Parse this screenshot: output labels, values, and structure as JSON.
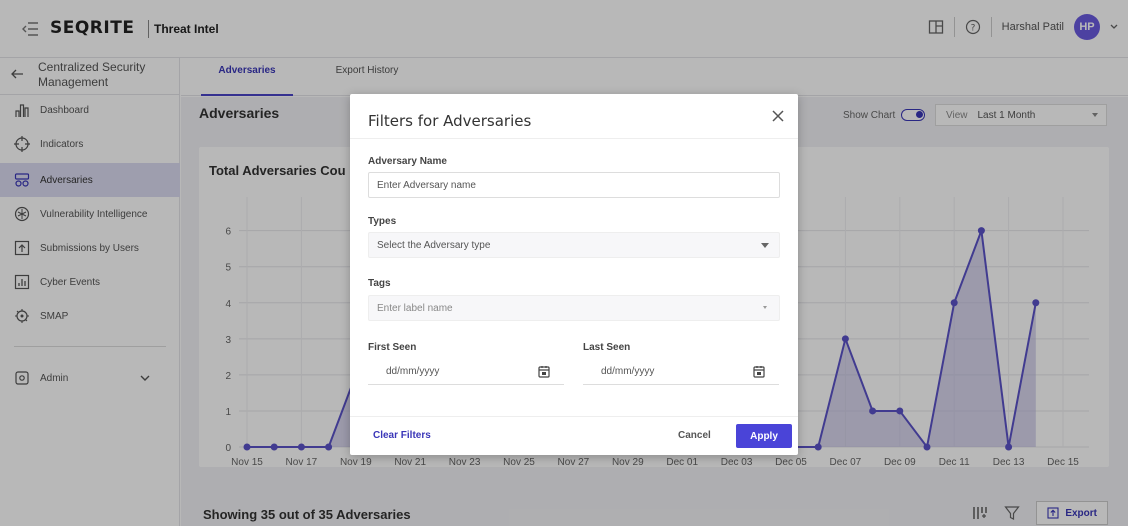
{
  "topbar": {
    "brand": "SEQRITE",
    "product": "Threat Intel",
    "username": "Harshal Patil",
    "avatar_initials": "HP"
  },
  "sidebar": {
    "header_title": "Centralized Security Management",
    "items": [
      {
        "label": "Dashboard",
        "icon": "bar-chart-icon"
      },
      {
        "label": "Indicators",
        "icon": "crosshair-icon"
      },
      {
        "label": "Adversaries",
        "icon": "adversary-icon",
        "active": true
      },
      {
        "label": "Vulnerability Intelligence",
        "icon": "bug-icon"
      },
      {
        "label": "Submissions by Users",
        "icon": "upload-icon"
      },
      {
        "label": "Cyber Events",
        "icon": "calendar-chart-icon"
      },
      {
        "label": "SMAP",
        "icon": "map-icon"
      }
    ],
    "admin_label": "Admin"
  },
  "tabs": [
    "Adversaries",
    "Export History"
  ],
  "main": {
    "page_title": "Adversaries",
    "show_chart_label": "Show Chart",
    "view_label": "View",
    "view_value": "Last 1 Month",
    "chart_title": "Total Adversaries Cou",
    "showing_text": "Showing 35 out of 35 Adversaries",
    "export_label": "Export"
  },
  "modal": {
    "title": "Filters for Adversaries",
    "name_label": "Adversary Name",
    "name_placeholder": "Enter Adversary name",
    "types_label": "Types",
    "types_placeholder": "Select the Adversary type",
    "tags_label": "Tags",
    "tags_placeholder": "Enter label name",
    "first_seen_label": "First Seen",
    "last_seen_label": "Last Seen",
    "date_placeholder": "dd/mm/yyyy",
    "clear_label": "Clear Filters",
    "cancel_label": "Cancel",
    "apply_label": "Apply"
  },
  "colors": {
    "accent": "#4a44d8",
    "series_line": "#5a52c8",
    "series_fill": "#b8b4de"
  },
  "chart_data": {
    "type": "area",
    "x": [
      "Nov 15",
      "Nov 16",
      "Nov 17",
      "Nov 18",
      "Nov 19",
      "Nov 20",
      "Nov 21",
      "Nov 22",
      "Nov 23",
      "Nov 24",
      "Nov 25",
      "Nov 26",
      "Nov 27",
      "Nov 28",
      "Nov 29",
      "Nov 30",
      "Dec 01",
      "Dec 02",
      "Dec 03",
      "Dec 04",
      "Dec 05",
      "Dec 06",
      "Dec 07",
      "Dec 08",
      "Dec 09",
      "Dec 10",
      "Dec 11",
      "Dec 12",
      "Dec 13",
      "Dec 14",
      "Dec 15"
    ],
    "x_tick_labels": [
      "Nov 15",
      "Nov 17",
      "Nov 19",
      "Nov 21",
      "Nov 23",
      "Nov 25",
      "Nov 27",
      "Nov 29",
      "Dec 01",
      "Dec 03",
      "Dec 05",
      "Dec 07",
      "Dec 09",
      "Dec 11",
      "Dec 13",
      "Dec 15"
    ],
    "values": [
      0,
      0,
      0,
      0,
      2,
      null,
      null,
      null,
      null,
      null,
      null,
      null,
      null,
      null,
      null,
      null,
      null,
      null,
      null,
      null,
      0,
      0,
      3,
      1,
      1,
      0,
      4,
      6,
      0,
      4,
      null
    ],
    "y_ticks": [
      0,
      1,
      2,
      3,
      4,
      5,
      6
    ],
    "ylim": [
      0,
      6.6
    ],
    "grid": true
  }
}
